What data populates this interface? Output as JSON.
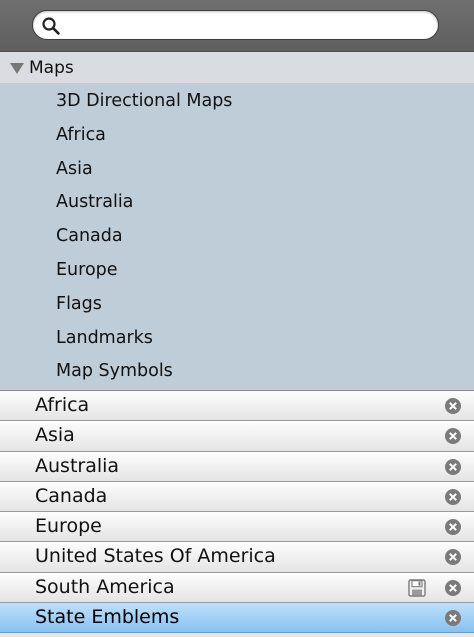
{
  "search": {
    "placeholder": "",
    "value": ""
  },
  "maps": {
    "header_label": "Maps",
    "items": [
      {
        "label": "3D Directional Maps"
      },
      {
        "label": "Africa"
      },
      {
        "label": "Asia"
      },
      {
        "label": "Australia"
      },
      {
        "label": "Canada"
      },
      {
        "label": "Europe"
      },
      {
        "label": "Flags"
      },
      {
        "label": "Landmarks"
      },
      {
        "label": "Map Symbols"
      }
    ]
  },
  "collections": [
    {
      "label": "Africa"
    },
    {
      "label": "Asia"
    },
    {
      "label": "Australia"
    },
    {
      "label": "Canada"
    },
    {
      "label": "Europe"
    },
    {
      "label": "United States Of America"
    },
    {
      "label": "South America"
    },
    {
      "label": "State Emblems"
    }
  ],
  "colors": {
    "search_bar_bg": "#666666",
    "maps_list_bg": "#bfcdd9",
    "selected_row": "#86c2f0",
    "remove_icon": "#7a7a7a"
  }
}
